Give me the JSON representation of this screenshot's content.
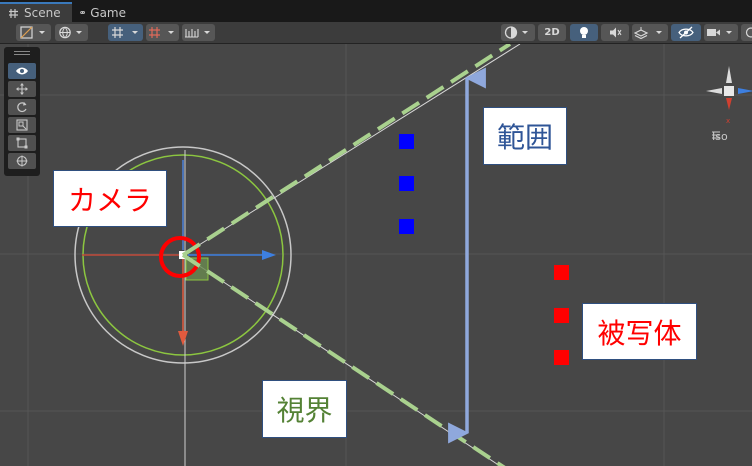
{
  "tabs": [
    {
      "label": "Scene",
      "icon": "grid-hash-icon"
    },
    {
      "label": "Game",
      "icon": "gamepad-icon"
    }
  ],
  "toolbar": {
    "toggle_2d_label": "2D"
  },
  "gizmo": {
    "projection_label": "Iso"
  },
  "annotations": {
    "camera": {
      "text": "カメラ",
      "color": "#ff0000"
    },
    "range": {
      "text": "範囲",
      "color": "#2f5597"
    },
    "target": {
      "text": "被写体",
      "color": "#ff0000"
    },
    "view": {
      "text": "視界",
      "color": "#548235"
    }
  },
  "colors": {
    "scene_background": "#474747",
    "frustum_line": "#a9d18e",
    "range_arrow": "#8fa8dc",
    "blue_object": "#0000ff",
    "red_object": "#ff0000",
    "camera_highlight": "#ff0000"
  }
}
